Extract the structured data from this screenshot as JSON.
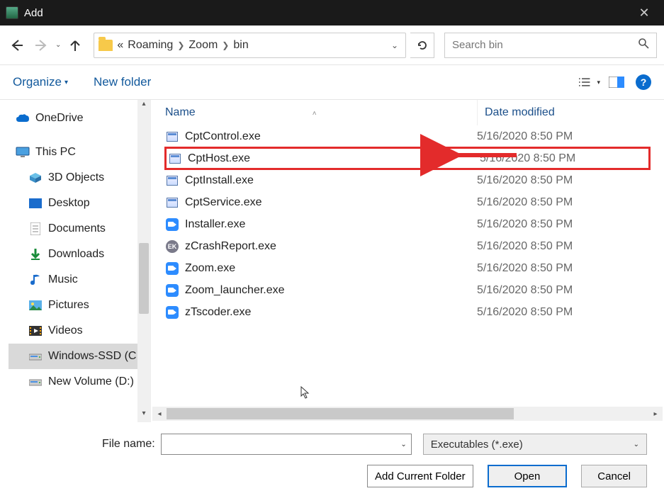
{
  "window": {
    "title": "Add"
  },
  "nav": {
    "crumbs": [
      "Roaming",
      "Zoom",
      "bin"
    ],
    "search_placeholder": "Search bin"
  },
  "toolbar": {
    "organize": "Organize",
    "new_folder": "New folder"
  },
  "sidebar": {
    "onedrive": "OneDrive",
    "this_pc": "This PC",
    "items": [
      {
        "label": "3D Objects",
        "icon": "cube"
      },
      {
        "label": "Desktop",
        "icon": "desktop"
      },
      {
        "label": "Documents",
        "icon": "doc"
      },
      {
        "label": "Downloads",
        "icon": "download"
      },
      {
        "label": "Music",
        "icon": "music"
      },
      {
        "label": "Pictures",
        "icon": "pictures"
      },
      {
        "label": "Videos",
        "icon": "videos"
      },
      {
        "label": "Windows-SSD (C",
        "icon": "drive",
        "selected": true
      },
      {
        "label": "New Volume (D:)",
        "icon": "drive"
      }
    ]
  },
  "columns": {
    "name": "Name",
    "date": "Date modified"
  },
  "files": [
    {
      "name": "CptControl.exe",
      "date": "5/16/2020 8:50 PM",
      "icon": "exe"
    },
    {
      "name": "CptHost.exe",
      "date": "5/16/2020 8:50 PM",
      "icon": "exe",
      "highlight": true
    },
    {
      "name": "CptInstall.exe",
      "date": "5/16/2020 8:50 PM",
      "icon": "exe"
    },
    {
      "name": "CptService.exe",
      "date": "5/16/2020 8:50 PM",
      "icon": "exe"
    },
    {
      "name": "Installer.exe",
      "date": "5/16/2020 8:50 PM",
      "icon": "zoom"
    },
    {
      "name": "zCrashReport.exe",
      "date": "5/16/2020 8:50 PM",
      "icon": "crash"
    },
    {
      "name": "Zoom.exe",
      "date": "5/16/2020 8:50 PM",
      "icon": "zoom"
    },
    {
      "name": "Zoom_launcher.exe",
      "date": "5/16/2020 8:50 PM",
      "icon": "zoom"
    },
    {
      "name": "zTscoder.exe",
      "date": "5/16/2020 8:50 PM",
      "icon": "zoom"
    }
  ],
  "bottom": {
    "filename_label": "File name:",
    "filename_value": "",
    "type_filter": "Executables (*.exe)",
    "add_folder": "Add Current Folder",
    "open": "Open",
    "cancel": "Cancel"
  }
}
